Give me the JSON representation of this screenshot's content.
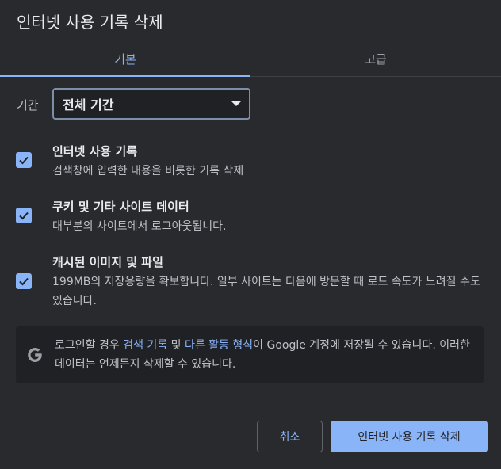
{
  "dialog": {
    "title": "인터넷 사용 기록 삭제"
  },
  "tabs": [
    {
      "label": "기본",
      "active": true
    },
    {
      "label": "고급",
      "active": false
    }
  ],
  "period": {
    "label": "기간",
    "selected": "전체 기간"
  },
  "options": [
    {
      "title": "인터넷 사용 기록",
      "desc": "검색창에 입력한 내용을 비롯한 기록 삭제",
      "checked": true
    },
    {
      "title": "쿠키 및 기타 사이트 데이터",
      "desc": "대부분의 사이트에서 로그아웃됩니다.",
      "checked": true
    },
    {
      "title": "캐시된 이미지 및 파일",
      "desc": "199MB의 저장용량을 확보합니다. 일부 사이트는 다음에 방문할 때 로드 속도가 느려질 수도 있습니다.",
      "checked": true
    }
  ],
  "notice": {
    "icon": "google-g-icon",
    "text_before": "로그인할 경우 ",
    "link_search": "검색 기록",
    "text_mid": " 및 ",
    "link_activity": "다른 활동 형식",
    "text_after": "이 Google 계정에 저장될 수 있습니다. 이러한 데이터는 언제든지 삭제할 수 있습니다."
  },
  "buttons": {
    "cancel": "취소",
    "confirm": "인터넷 사용 기록 삭제"
  },
  "colors": {
    "accent": "#8ab4f8",
    "background": "#292a2d",
    "panel": "#202124"
  }
}
